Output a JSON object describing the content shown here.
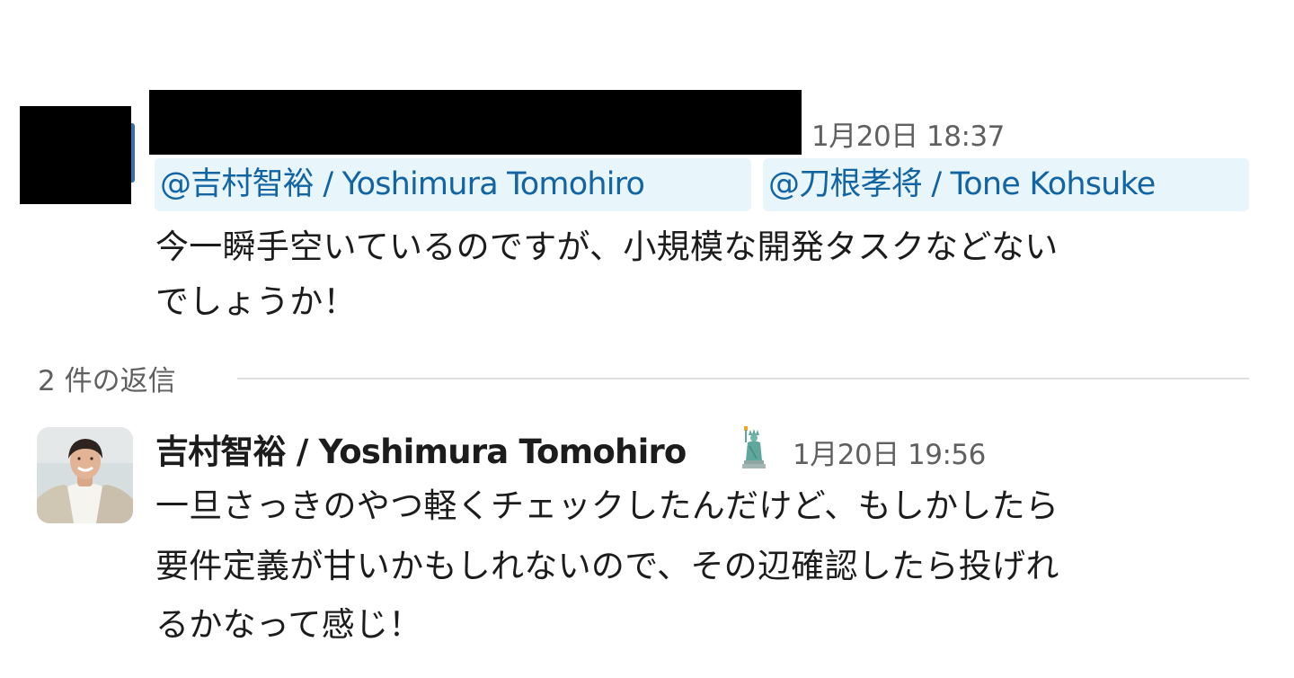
{
  "message1": {
    "author_redacted": true,
    "timestamp": "1月20日 18:37",
    "mentions": [
      "@吉村智裕 / Yoshimura Tomohiro",
      "@刀根孝将 / Tone Kohsuke"
    ],
    "lines": [
      "今一瞬手空いているのですが、小規模な開発タスクなどない",
      "でしょうか！"
    ]
  },
  "thread": {
    "replies_label": "2 件の返信"
  },
  "message2": {
    "author": "吉村智裕 / Yoshimura Tomohiro",
    "status_icon": "statue-of-liberty-icon",
    "timestamp": "1月20日 19:56",
    "lines": [
      "一旦さっきのやつ軽くチェックしたんだけど、もしかしたら",
      "要件定義が甘いかもしれないので、その辺確認したら投げれ",
      "るかなって感じ！"
    ]
  },
  "colors": {
    "mention_bg": "#e8f5fa",
    "mention_text": "#1264a3",
    "timestamp": "#616061",
    "divider": "#dddddd"
  }
}
